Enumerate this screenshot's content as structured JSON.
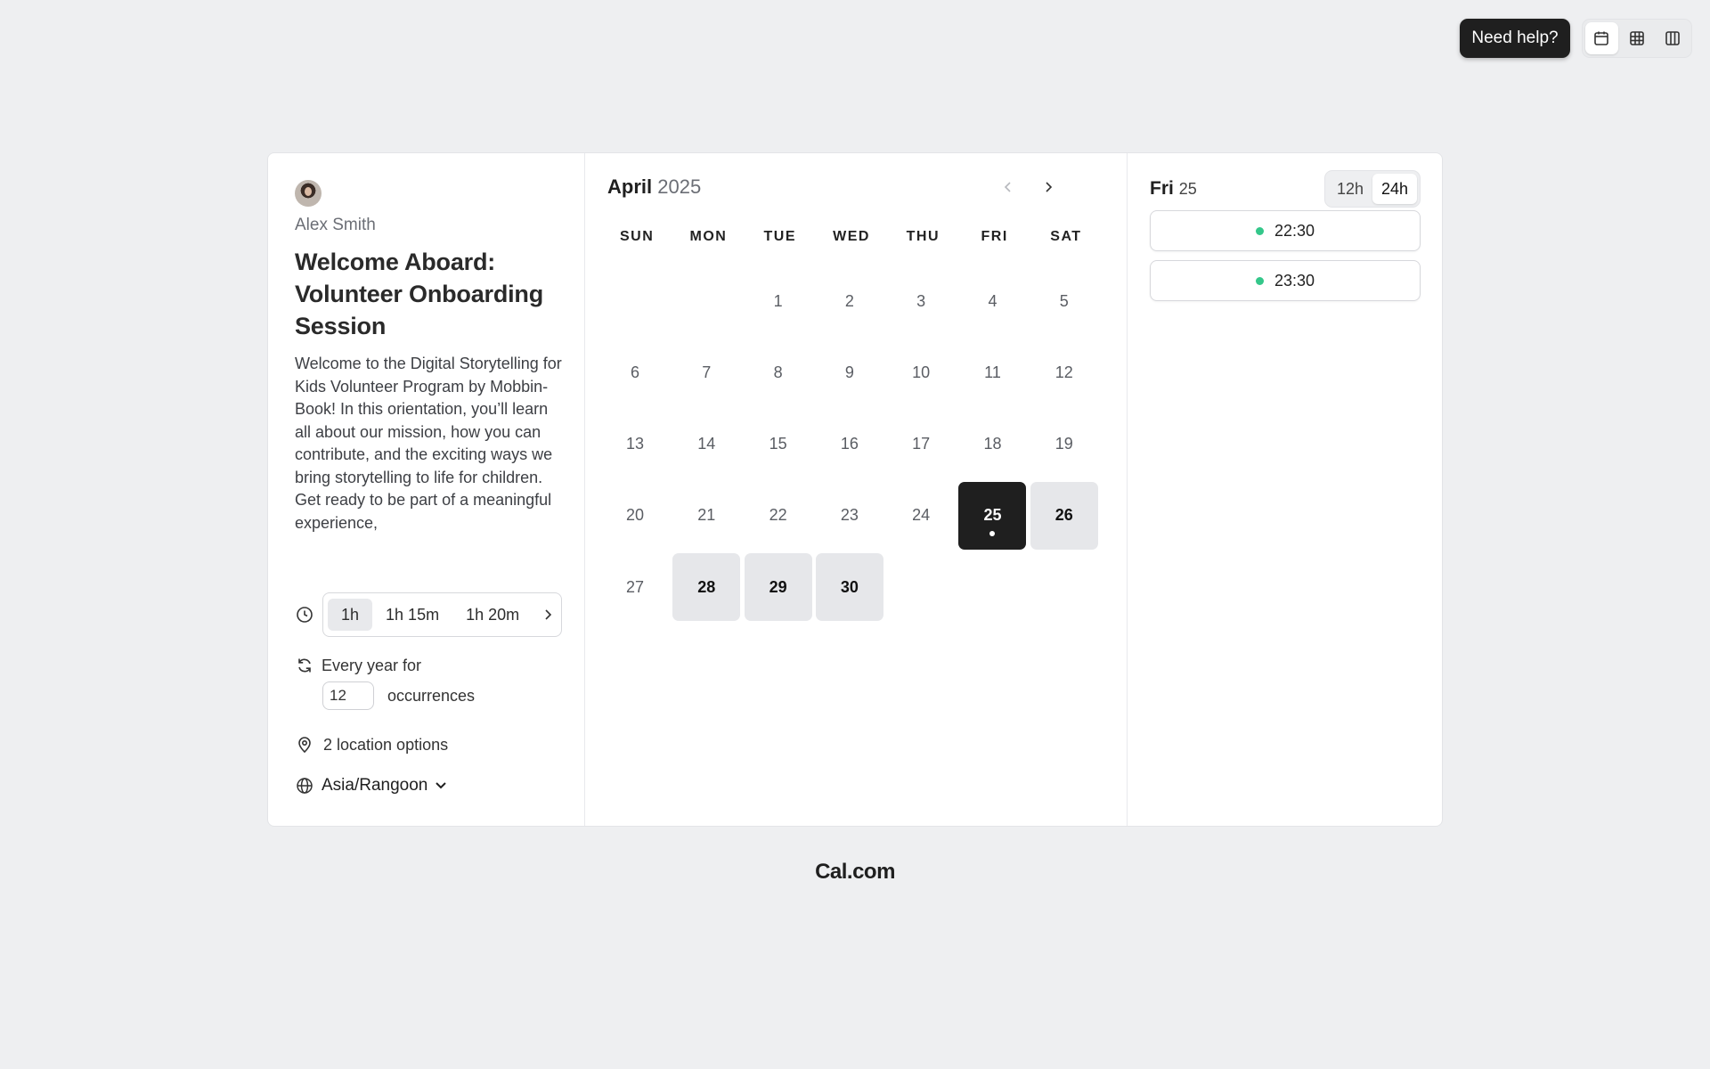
{
  "topbar": {
    "help_label": "Need help?",
    "views": [
      {
        "icon": "calendar-icon",
        "active": true
      },
      {
        "icon": "grid-icon",
        "active": false
      },
      {
        "icon": "columns-icon",
        "active": false
      }
    ]
  },
  "event": {
    "host_name": "Alex Smith",
    "title": "Welcome Aboard: Volunteer Onboarding Session",
    "description": "Welcome to the Digital Storytelling for Kids Volunteer Program by Mobbin-Book! In this orientation, you’ll learn all about our mission, how you can contribute, and the exciting ways we bring storytelling to life for children. Get ready to be part of a meaningful experience,",
    "durations": [
      "1h",
      "1h 15m",
      "1h 20m"
    ],
    "selected_duration": "1h",
    "recurrence_label": "Every year for",
    "occurrences_value": "12",
    "occurrences_label": "occurrences",
    "location_label": "2 location options",
    "timezone": "Asia/Rangoon"
  },
  "calendar": {
    "month": "April",
    "year": "2025",
    "weekdays": [
      "SUN",
      "MON",
      "TUE",
      "WED",
      "THU",
      "FRI",
      "SAT"
    ],
    "leading_blanks": 2,
    "days": [
      "1",
      "2",
      "3",
      "4",
      "5",
      "6",
      "7",
      "8",
      "9",
      "10",
      "11",
      "12",
      "13",
      "14",
      "15",
      "16",
      "17",
      "18",
      "19",
      "20",
      "21",
      "22",
      "23",
      "24",
      "25",
      "26",
      "27",
      "28",
      "29",
      "30"
    ],
    "available_days": [
      "26",
      "28",
      "29",
      "30"
    ],
    "selected_day": "25"
  },
  "slots": {
    "day_label": "Fri",
    "day_number": "25",
    "format_options": [
      "12h",
      "24h"
    ],
    "active_format": "24h",
    "times": [
      "22:30",
      "23:30"
    ]
  },
  "footer": {
    "brand": "Cal.com"
  },
  "colors": {
    "background": "#eeeff1",
    "selected": "#1f1f1f",
    "available": "#e6e7ea",
    "slot_dot": "#34c78a"
  }
}
